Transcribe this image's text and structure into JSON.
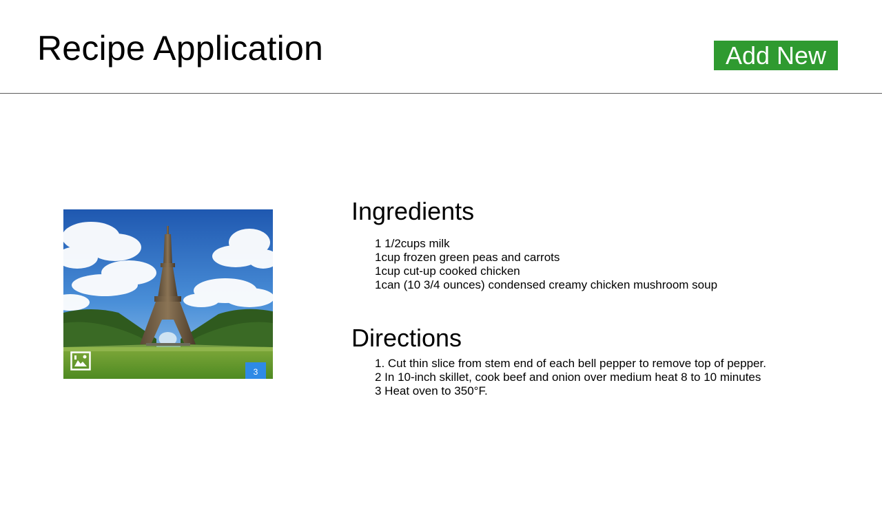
{
  "header": {
    "title": "Recipe Application",
    "add_button_label": "Add New"
  },
  "photo": {
    "alt": "Eiffel Tower",
    "icon": "image-gallery-icon",
    "count": "3"
  },
  "ingredients": {
    "title": "Ingredients",
    "items": [
      "1 1/2cups milk",
      "1cup frozen green peas and carrots",
      "1cup cut-up cooked chicken",
      "1can (10 3/4 ounces) condensed creamy chicken mushroom soup"
    ]
  },
  "directions": {
    "title": "Directions",
    "items": [
      "1.  Cut thin slice from stem end of each bell pepper to remove top of pepper.",
      "2 In 10-inch skillet, cook beef and onion over medium heat 8 to 10 minutes",
      "3 Heat oven to 350°F."
    ]
  },
  "colors": {
    "accent_green": "#2f9a30",
    "badge_blue": "#2e8ae6",
    "divider": "#5a5a5a"
  }
}
